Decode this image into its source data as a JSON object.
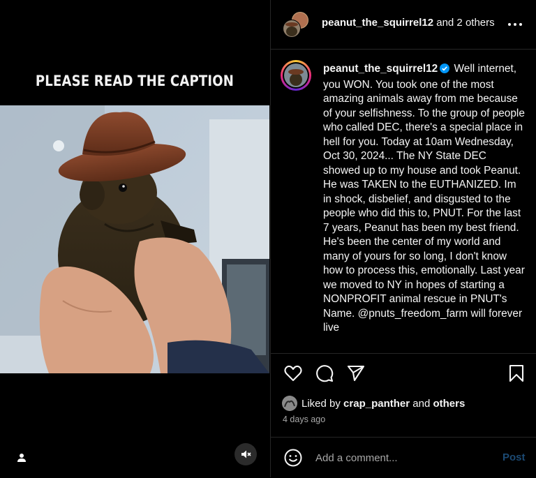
{
  "media": {
    "overlay_text": "PLEASE READ THE CAPTION"
  },
  "header": {
    "username": "peanut_the_squirrel12",
    "others_text": "and 2 others"
  },
  "caption": {
    "username": "peanut_the_squirrel12",
    "text": "Well internet, you WON. You took one of the most amazing animals away from me because of your selfishness. To the group of people who called DEC, there's a special place in hell for you. Today at 10am Wednesday, Oct 30, 2024... The NY State DEC showed up to my house and took Peanut. He was TAKEN to the EUTHANIZED. Im in shock, disbelief, and disgusted to the people who did this to, PNUT. For the last 7 years, Peanut has been my best friend. He's been the center of my world and many of yours for so long, I don't know how to process this, emotionally. Last year we moved to NY in hopes of starting a NONPROFIT animal rescue in PNUT's Name. @pnuts_freedom_farm will forever live"
  },
  "likes": {
    "prefix": "Liked by",
    "user": "crap_panther",
    "conj": "and",
    "others": "others"
  },
  "timestamp": "4 days ago",
  "comment": {
    "placeholder": "Add a comment...",
    "post_label": "Post"
  },
  "icons": {
    "like": "heart-icon",
    "comment": "comment-icon",
    "share": "paper-plane-icon",
    "save": "bookmark-icon",
    "emoji": "smiley-icon",
    "more": "more-dots-icon",
    "mute": "speaker-muted-icon",
    "user_tag": "person-icon",
    "verified": "verified-badge-icon"
  },
  "colors": {
    "background": "#000000",
    "border": "#262626",
    "verified": "#0095f6",
    "post_disabled": "#1c4a73",
    "muted_text": "#a8a8a8"
  }
}
